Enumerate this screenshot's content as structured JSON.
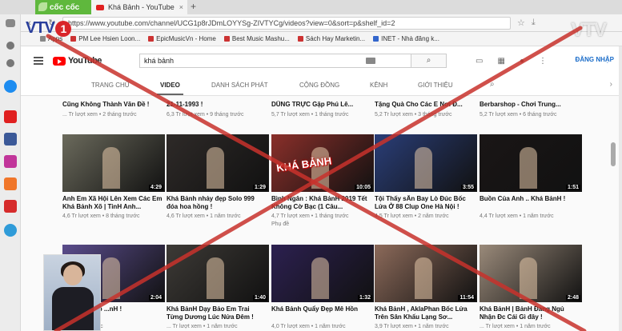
{
  "browser": {
    "brand_tab": "cốc cốc",
    "tab_title": "Khá Bảnh - YouTube",
    "tab_close": "×",
    "new_tab": "+",
    "url": "https://www.youtube.com/channel/UCG1p8rJDmLOYYSg-ZIVTYCg/videos?view=0&sort=p&shelf_id=2",
    "bookmarks": [
      {
        "label": "Apps",
        "color": "#888888"
      },
      {
        "label": "PM Lee Hsien Loon...",
        "color": "#cc3333"
      },
      {
        "label": "EpicMusicVn - Home",
        "color": "#cc3333"
      },
      {
        "label": "Best Music Mashu...",
        "color": "#cc3333"
      },
      {
        "label": "Sách Hay Marketin...",
        "color": "#cc3333"
      },
      {
        "label": "INET - Nhà đăng k...",
        "color": "#3366cc"
      }
    ]
  },
  "youtube": {
    "logo": "YouTube",
    "search_value": "khá bảnh",
    "login": "ĐĂNG NHẬP",
    "tabs": [
      "TRANG CHỦ",
      "VIDEO",
      "DANH SÁCH PHÁT",
      "CỘNG ĐỒNG",
      "KÊNH",
      "GIỚI THIỆU"
    ]
  },
  "partial_row": [
    {
      "title": "Cũng Không Thành Văn Đề !",
      "meta": "... Tr lượt xem • 2 tháng trước"
    },
    {
      "title": "21-11-1993 !",
      "meta": "6,3 Tr lượt xem • 9 tháng trước"
    },
    {
      "title": "DŨNG TRỰC Gặp Phú Lê...",
      "meta": "5,7 Tr lượt xem • 1 tháng trước"
    },
    {
      "title": "Tặng Quà Cho Các E Nơi Đ...",
      "meta": "5,2 Tr lượt xem • 3 tháng trước"
    },
    {
      "title": "Berbarshop - Chơi Trung...",
      "meta": "5,2 Tr lượt xem • 6 tháng trước"
    }
  ],
  "row1": [
    {
      "title": "Anh Em Xã Hội Lên Xem Các Em Khá Bảnh Xõ | TinH Anh...",
      "meta": "4,6 Tr lượt xem • 8 tháng trước",
      "duration": "4:29",
      "bg": "#6b6a5c"
    },
    {
      "title": "Khá Bảnh nhảy đẹp Solo 999 đóa hoa hồng !",
      "meta": "4,6 Tr lượt xem • 1 năm trước",
      "duration": "1:29",
      "bg": "#2e2a28"
    },
    {
      "title": "Bình Ngân : Khá BảnH 2019 Tết Không Cờ Bạc (1 Câu...",
      "meta": "4,7 Tr lượt xem • 1 tháng trước",
      "meta2": "Phụ đề",
      "duration": "10:05",
      "bg": "#8a2f2a"
    },
    {
      "title": "Tội Thấy sÂn Bay Lò Đúc Bốc Lửa Ở 88 Clup One Hà Nội !",
      "meta": "4,5 Tr lượt xem • 2 năm trước",
      "duration": "3:55",
      "bg": "#2a3e78"
    },
    {
      "title": "Buồn Của Anh .. Khá BảnH !",
      "meta": "4,4 Tr lượt xem • 1 năm trước",
      "duration": "1:51",
      "bg": "#1a1616"
    }
  ],
  "row2": [
    {
      "title": "...y đẹp khớp ...nH !",
      "meta": "... • 2 năm trước",
      "duration": "2:04",
      "bg": "#5a4c8c"
    },
    {
      "title": "Khá BảnH Dạy Bảo Em Trai Từng Dương Lúc Nửa Đêm !",
      "meta": "... Tr lượt xem • 1 năm trước",
      "duration": "1:40",
      "bg": "#3d3a36"
    },
    {
      "title": "Khá Bảnh Quẩy Đẹp Mê Hồn",
      "meta": "4,0 Tr lượt xem • 1 năm trước",
      "duration": "1:32",
      "bg": "#2c2050"
    },
    {
      "title": "Khá BảnH , AklaPhan Bốc Lửa Trên Sân Khấu Lạng Sơ...",
      "meta": "3,9 Tr lượt xem • 1 năm trước",
      "duration": "11:54",
      "bg": "#8c6a5a"
    },
    {
      "title": "Khá BảnH | BảnH Đang Ngủ Nhận Đc Cái Gì đây !",
      "meta": "... Tr lượt xem • 1 năm trước",
      "duration": "2:48",
      "bg": "#9a8a7a"
    }
  ],
  "overlay": {
    "logo_text": "VTV",
    "logo_number": "1",
    "watermark": "VTV",
    "thumb_text": "KHÁ BẢNH"
  },
  "colors": {
    "yt_red": "#ff0000",
    "vtv_blue": "#2a3f9c",
    "vtv_red": "#d9252a",
    "cross_red": "#c8322c",
    "coccoc_green": "#5fb83d"
  }
}
